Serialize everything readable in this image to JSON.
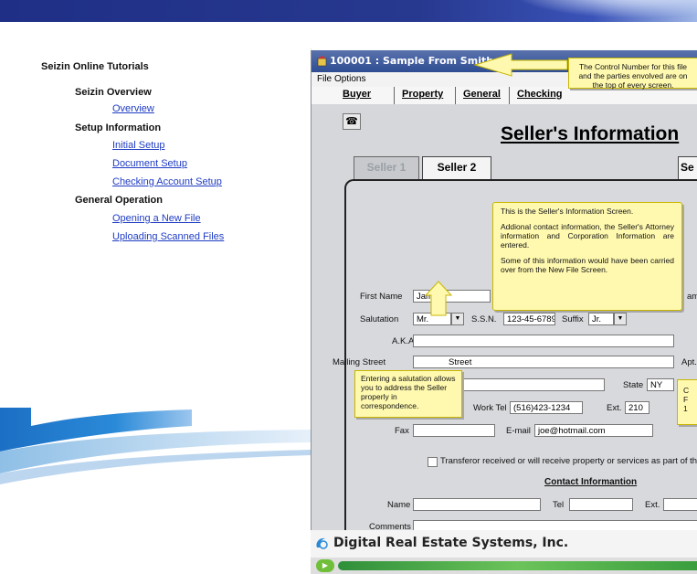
{
  "nav": {
    "title": "Seizin Online Tutorials",
    "sections": [
      {
        "heading": "Seizin Overview",
        "links": [
          "Overview"
        ]
      },
      {
        "heading": "Setup Information",
        "links": [
          "Initial Setup",
          "Document Setup",
          "Checking Account Setup"
        ]
      },
      {
        "heading": "General Operation",
        "links": [
          "Opening a New File",
          "Uploading  Scanned  Files"
        ]
      }
    ]
  },
  "app": {
    "window_title": "100001 : Sample From Smith",
    "menu": [
      "File",
      "Options"
    ],
    "tabs": [
      "Buyer",
      "Property",
      "General",
      "Checking"
    ],
    "heading": "Seller's Information",
    "seller_tabs": [
      "Seller 1",
      "Seller 2",
      "Se"
    ],
    "fields": {
      "first_name_label": "First Name",
      "first_name": "James",
      "first_name_trail": "am",
      "salutation_label": "Salutation",
      "salutation": "Mr.",
      "ssn_label": "S.S.N.",
      "ssn": "123-45-6789",
      "suffix_label": "Suffix",
      "suffix": "Jr.",
      "aka_label": "A.K.A.",
      "mailing_label": "Mailing Street",
      "mailing_value": "Street",
      "apt_label": "Apt.",
      "state_label": "State",
      "state": "NY",
      "home_tel_partial": "34",
      "work_tel_label": "Work Tel",
      "work_tel": "(516)423-1234",
      "ext_label": "Ext.",
      "ext": "210",
      "fax_label": "Fax",
      "email_label": "E-mail",
      "email": "joe@hotmail.com",
      "transferor_text": "Transferor received or will receive property or services as part of the",
      "contact_heading": "Contact Informantion",
      "name_label": "Name",
      "tel_label": "Tel",
      "ext2_label": "Ext.",
      "comments_label": "Comments"
    },
    "callouts": {
      "control_number": "The Control Number for this file and the parties envolved are on the top of every screen.",
      "seller_info_p1": "This is the Seller's Information Screen.",
      "seller_info_p2": "Addional contact information, the Seller's Attorney information and Corporation Information are entered.",
      "seller_info_p3": "Some of this information would have been carried over from the New File Screen.",
      "salutation": "Entering a salutation allows you to address the Seller properly in correspondence.",
      "right_partial_1": "C",
      "right_partial_2": "F",
      "right_partial_3": "1"
    },
    "footer": "Digital Real Estate Systems, Inc."
  },
  "colors": {
    "banner": "#27388f",
    "link": "#1f3cc4",
    "callout_bg": "#fff9b0",
    "title_bar": "#2e4c92",
    "heading": "#000000"
  }
}
